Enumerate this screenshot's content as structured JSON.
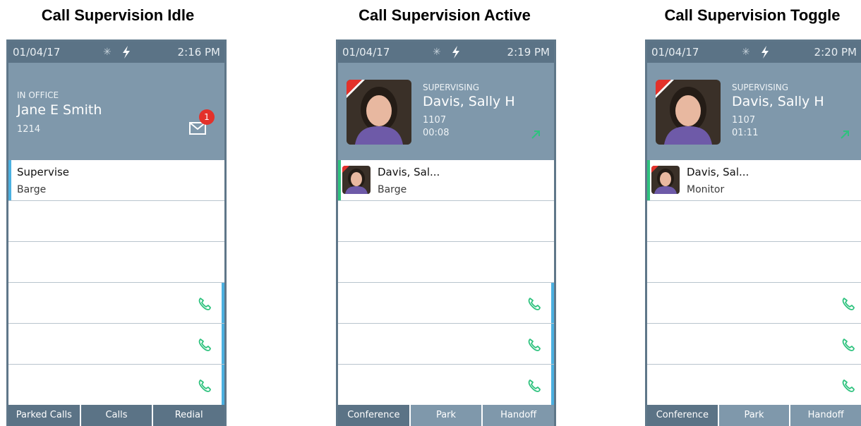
{
  "screens": [
    {
      "caption": "Call Supervision Idle",
      "status": {
        "date": "01/04/17",
        "time": "2:16 PM"
      },
      "header": {
        "presence": "IN OFFICE",
        "name": "Jane E Smith",
        "extension": "1214",
        "voicemail_count": "1"
      },
      "lines": [
        {
          "title": "Supervise",
          "subtitle": "Barge"
        }
      ],
      "tabs": [
        "Parked Calls",
        "Calls",
        "Redial"
      ]
    },
    {
      "caption": "Call Supervision Active",
      "status": {
        "date": "01/04/17",
        "time": "2:19 PM"
      },
      "header": {
        "label": "SUPERVISING",
        "name": "Davis, Sally H",
        "extension": "1107",
        "timer": "00:08"
      },
      "lines": [
        {
          "title": "Davis, Sal...",
          "subtitle": "Barge"
        }
      ],
      "tabs": [
        "Conference",
        "Park",
        "Handoff"
      ]
    },
    {
      "caption": "Call Supervision Toggle",
      "status": {
        "date": "01/04/17",
        "time": "2:20 PM"
      },
      "header": {
        "label": "SUPERVISING",
        "name": "Davis, Sally H",
        "extension": "1107",
        "timer": "01:11"
      },
      "lines": [
        {
          "title": "Davis, Sal...",
          "subtitle": "Monitor"
        }
      ],
      "tabs": [
        "Conference",
        "Park",
        "Handoff"
      ]
    }
  ],
  "icons": {
    "bluetooth": "bluetooth-icon",
    "power": "lightning-bolt-icon",
    "voicemail": "envelope-icon",
    "call": "phone-handset-icon",
    "outgoing": "outgoing-arrow-icon"
  },
  "colors": {
    "statusbar": "#5b7386",
    "header": "#7f98ab",
    "accent_blue": "#4bb0e0",
    "accent_green": "#2ec27e",
    "badge_red": "#e3312a"
  }
}
